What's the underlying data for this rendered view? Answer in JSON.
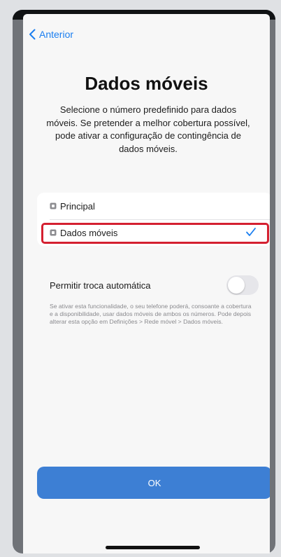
{
  "nav": {
    "back_label": "Anterior"
  },
  "header": {
    "title": "Dados móveis",
    "description": "Selecione o número predefinido para dados móveis. Se pretender a melhor cobertura possível, pode ativar a configuração de contingência de dados móveis."
  },
  "options": [
    {
      "label": "Principal",
      "selected": false
    },
    {
      "label": "Dados móveis",
      "selected": true
    }
  ],
  "auto_switch": {
    "label": "Permitir troca automática",
    "enabled": false,
    "footnote": "Se ativar esta funcionalidade, o seu telefone poderá, consoante a cobertura e a disponibilidade, usar dados móveis de ambos os números. Pode depois alterar esta opção em Definições > Rede móvel > Dados móveis."
  },
  "actions": {
    "ok_label": "OK"
  },
  "colors": {
    "accent": "#1a7ef0",
    "button": "#3d7fd4",
    "highlight": "#d42030"
  }
}
